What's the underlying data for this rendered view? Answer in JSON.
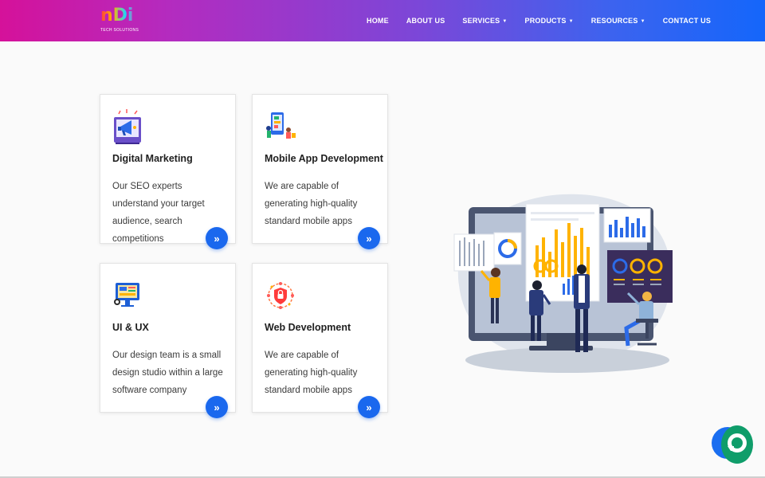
{
  "brand": {
    "logo_text": "nDi",
    "tagline": "TECH SOLUTIONS"
  },
  "nav": {
    "items": [
      {
        "label": "HOME",
        "dropdown": false
      },
      {
        "label": "ABOUT US",
        "dropdown": false
      },
      {
        "label": "SERVICES",
        "dropdown": true
      },
      {
        "label": "PRODUCTS",
        "dropdown": true
      },
      {
        "label": "RESOURCES",
        "dropdown": true
      },
      {
        "label": "CONTACT US",
        "dropdown": false
      }
    ]
  },
  "services": [
    {
      "title": "Digital Marketing",
      "text": "Our SEO experts understand your target audience, search competitions",
      "icon": "megaphone-icon",
      "button": "»"
    },
    {
      "title": "Mobile App Development",
      "text": "We are capable of generating high-quality standard mobile apps",
      "icon": "mobile-app-icon",
      "button": "»"
    },
    {
      "title": "UI & UX",
      "text": "Our design team is a small design studio within a large software company",
      "icon": "ui-design-icon",
      "button": "»"
    },
    {
      "title": "Web Development",
      "text": "We are capable of generating high-quality standard mobile apps",
      "icon": "web-security-icon",
      "button": "»"
    }
  ],
  "colors": {
    "nav_gradient_start": "#d5119a",
    "nav_gradient_end": "#1466fb",
    "accent_blue": "#1a68ee",
    "chat_green": "#0f9d6a"
  },
  "hero": {
    "illustration": "analytics-team-illustration"
  },
  "chat": {
    "icon": "chat-bubble-icon"
  }
}
